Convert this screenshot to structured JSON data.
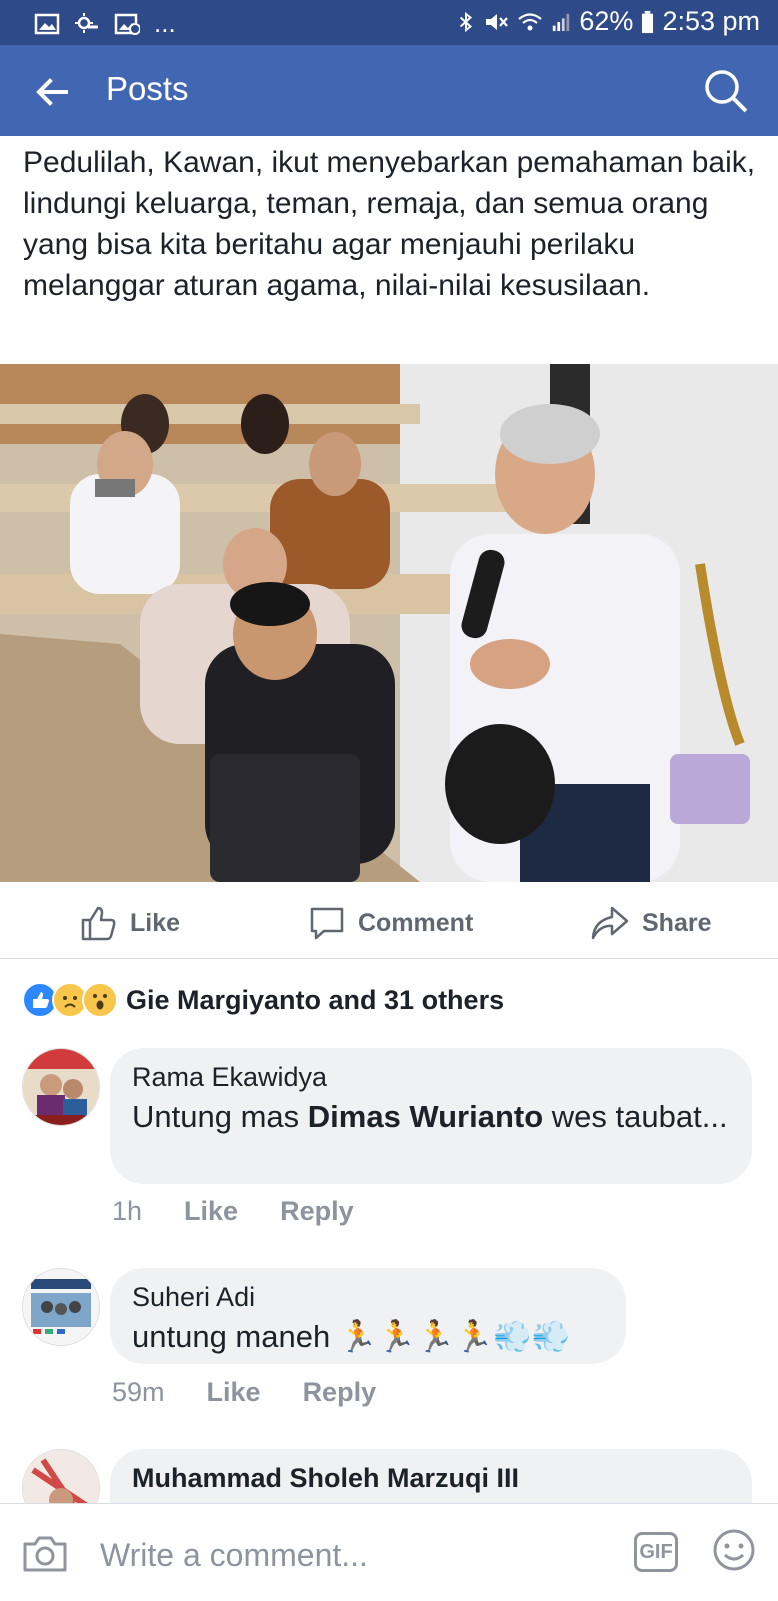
{
  "status_bar": {
    "battery_percent": "62%",
    "time": "2:53 pm",
    "overflow_dots": "...",
    "icons": [
      "image-icon",
      "weather-icon",
      "photo-g-icon",
      "bluetooth-icon",
      "mute-icon",
      "wifi-icon",
      "signal-icon",
      "battery-icon"
    ]
  },
  "app_bar": {
    "title": "Posts",
    "back_icon": "back-arrow-icon",
    "search_icon": "search-icon",
    "background": "#4267b2"
  },
  "post": {
    "text": "Pedulilah, Kawan, ikut menyebarkan pemahaman baik, lindungi keluarga, teman, remaja, dan semua orang yang bisa kita beritahu agar menjauhi perilaku melanggar aturan agama, nilai-nilai kesusilaan."
  },
  "actions": {
    "like": "Like",
    "comment": "Comment",
    "share": "Share"
  },
  "reactions": {
    "summary": "Gie Margiyanto and 31 others",
    "types": [
      "like",
      "sad",
      "wow"
    ]
  },
  "comments": [
    {
      "author": "Rama Ekawidya",
      "text_before": "Untung mas ",
      "mention": "Dimas Wurianto",
      "text_after": " wes taubat...",
      "time": "1h",
      "like": "Like",
      "reply": "Reply"
    },
    {
      "author": "Suheri Adi",
      "text": "untung maneh 🏃🏃🏃🏃💨💨",
      "time": "59m",
      "like": "Like",
      "reply": "Reply"
    },
    {
      "author": "Muhammad Sholeh Marzuqi III"
    }
  ],
  "composer": {
    "placeholder": "Write a comment...",
    "gif_label": "GIF"
  },
  "colors": {
    "status_bar": "#2e4a88",
    "brand_blue": "#4267b2",
    "bubble": "#f0f1f3",
    "meta_gray": "#8d949e"
  }
}
